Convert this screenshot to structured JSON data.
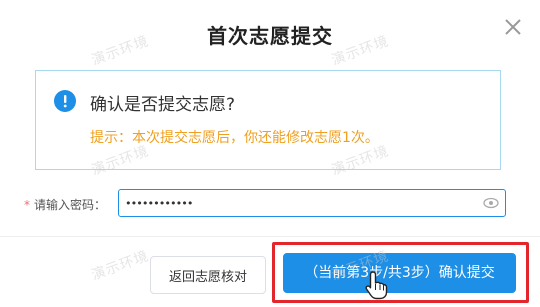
{
  "dialog": {
    "title": "首次志愿提交",
    "close_icon": "close-icon"
  },
  "notice": {
    "icon": "info-icon",
    "question": "确认是否提交志愿?",
    "hint": "提示：本次提交志愿后，你还能修改志愿1次。"
  },
  "password": {
    "required_mark": "*",
    "label": "请输入密码：",
    "value": "••••••••••••"
  },
  "buttons": {
    "back_label": "返回志愿核对",
    "submit_label": "（当前第3步/共3步）确认提交"
  },
  "watermark": "演示环境",
  "colors": {
    "primary": "#1e8fe6",
    "hint": "#f0a020",
    "highlight": "#e3262c",
    "border": "#a8d8f0"
  }
}
